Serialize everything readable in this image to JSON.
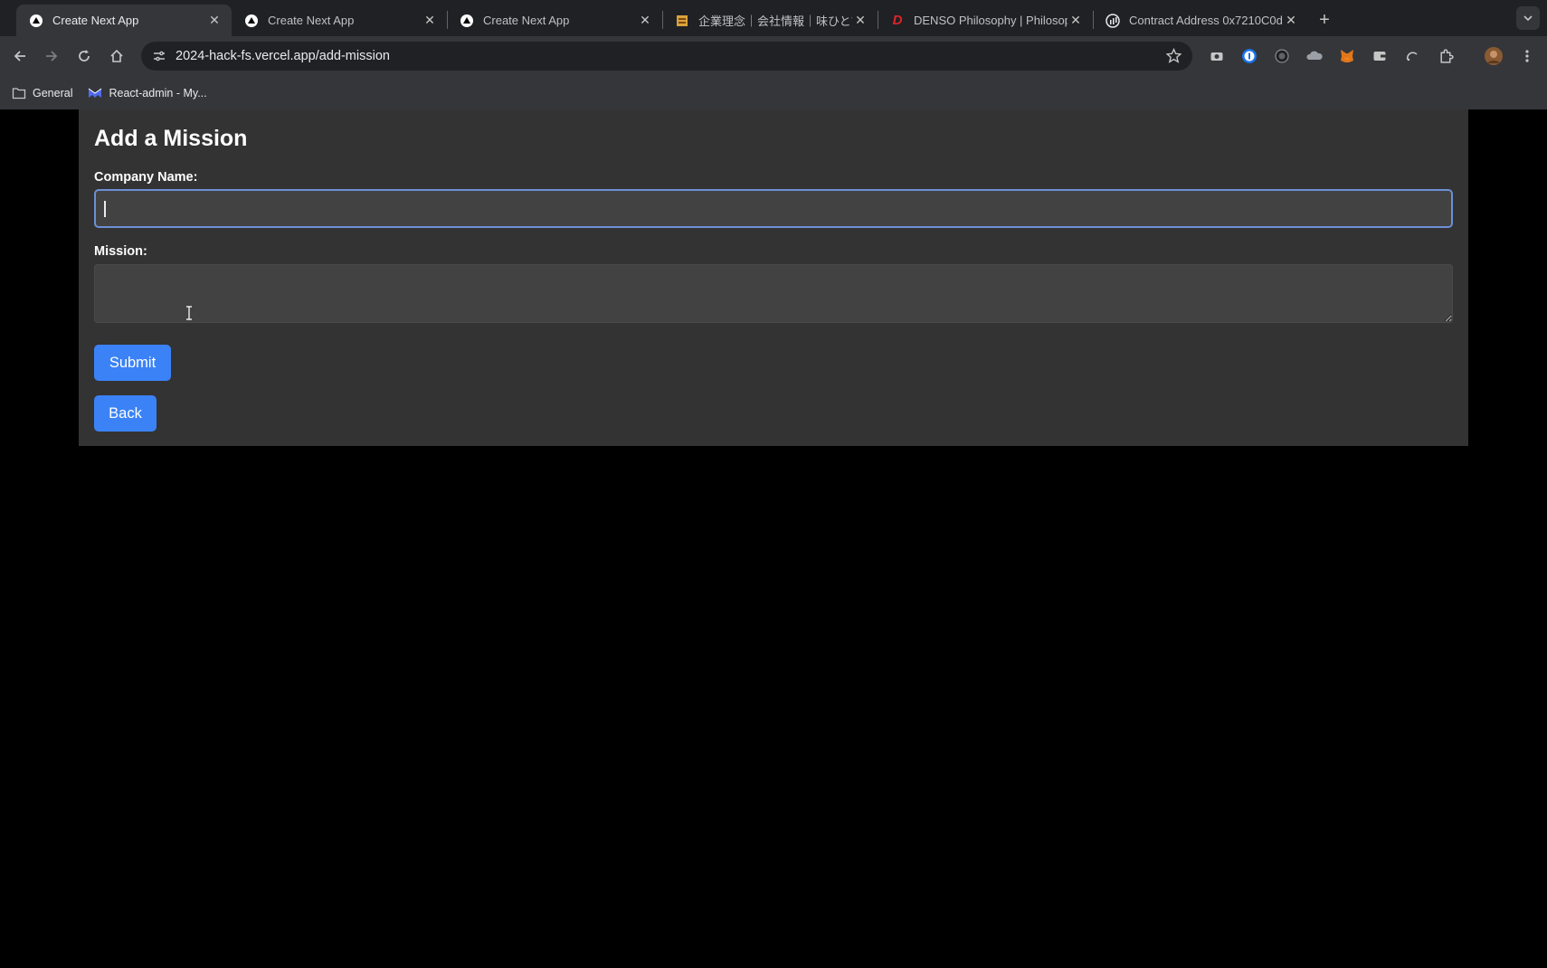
{
  "browser": {
    "tabs": [
      {
        "title": "Create Next App",
        "icon": "triangle-icon",
        "active": true
      },
      {
        "title": "Create Next App",
        "icon": "triangle-icon",
        "active": false
      },
      {
        "title": "Create Next App",
        "icon": "triangle-icon",
        "active": false
      },
      {
        "title": "企業理念｜会社情報｜味ひとすじ",
        "icon": "brand-icon",
        "active": false
      },
      {
        "title": "DENSO Philosophy | Philosop",
        "icon": "denso-icon",
        "active": false
      },
      {
        "title": "Contract Address 0x7210C0d",
        "icon": "etherscan-icon",
        "active": false
      }
    ],
    "url_host": "2024-hack-fs.vercel.app",
    "url_path": "/add-mission",
    "bookmarks": [
      {
        "label": "General",
        "icon": "folder-icon"
      },
      {
        "label": "React-admin - My...",
        "icon": "react-admin-icon"
      }
    ]
  },
  "form": {
    "title": "Add a Mission",
    "company_label": "Company Name:",
    "company_value": "",
    "mission_label": "Mission:",
    "mission_value": "",
    "submit_label": "Submit",
    "back_label": "Back"
  },
  "colors": {
    "accent": "#3b82f6",
    "focus_border": "#6c8fd6",
    "card_bg": "#333333"
  }
}
